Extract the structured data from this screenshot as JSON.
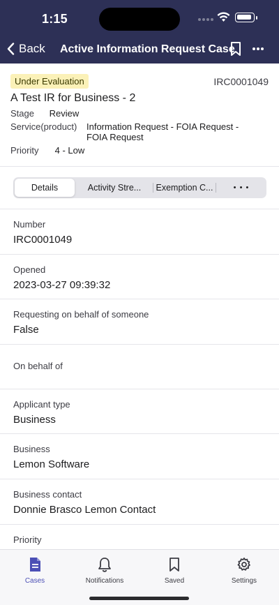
{
  "status_bar": {
    "time": "1:15"
  },
  "nav": {
    "back_label": "Back",
    "title": "Active Information Request Case"
  },
  "summary": {
    "badge": "Under Evaluation",
    "case_number": "IRC0001049",
    "title": "A Test IR for Business - 2",
    "stage_label": "Stage",
    "stage_value": "Review",
    "service_label": "Service(product)",
    "service_value": "Information Request - FOIA Request - FOIA Request",
    "priority_label": "Priority",
    "priority_value": "4 - Low"
  },
  "tabs": [
    {
      "label": "Details",
      "active": true
    },
    {
      "label": "Activity Stre..."
    },
    {
      "label": "Exemption C..."
    },
    {
      "label": "• • •"
    }
  ],
  "fields": [
    {
      "label": "Number",
      "value": "IRC0001049"
    },
    {
      "label": "Opened",
      "value": "2023-03-27 09:39:32"
    },
    {
      "label": "Requesting on behalf of someone",
      "value": "False"
    },
    {
      "label": "On behalf of",
      "value": ""
    },
    {
      "label": "Applicant type",
      "value": "Business"
    },
    {
      "label": "Business",
      "value": "Lemon Software"
    },
    {
      "label": "Business contact",
      "value": "Donnie Brasco Lemon Contact"
    },
    {
      "label": "Priority",
      "value": ""
    }
  ],
  "bottom_tabs": [
    {
      "label": "Cases",
      "icon": "cases-icon",
      "active": true
    },
    {
      "label": "Notifications",
      "icon": "bell-icon"
    },
    {
      "label": "Saved",
      "icon": "bookmark-icon"
    },
    {
      "label": "Settings",
      "icon": "gear-icon"
    }
  ],
  "colors": {
    "header_bg": "#2d3056",
    "badge_bg": "#fbf1b8",
    "accent": "#4b4fb5"
  }
}
